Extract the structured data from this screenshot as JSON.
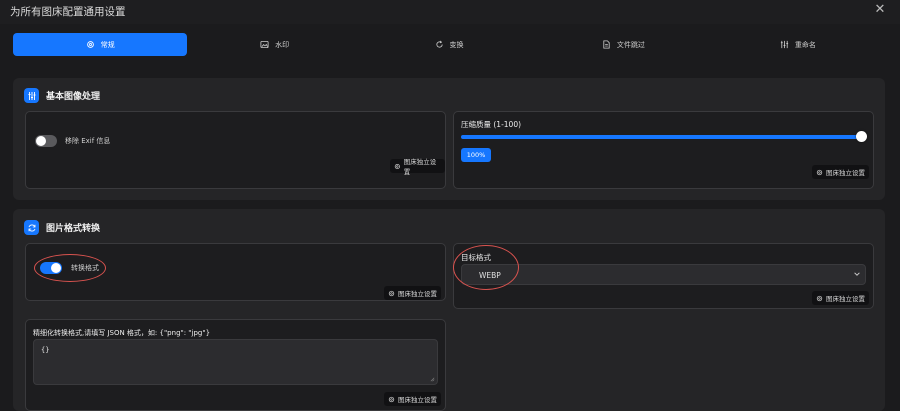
{
  "window": {
    "title": "为所有图床配置通用设置",
    "close_glyph": "✕"
  },
  "tabs": [
    {
      "label": "常规",
      "icon": "gear-icon",
      "active": true
    },
    {
      "label": "水印",
      "icon": "image-icon",
      "active": false
    },
    {
      "label": "变换",
      "icon": "rotate-icon",
      "active": false
    },
    {
      "label": "文件跳过",
      "icon": "file-icon",
      "active": false
    },
    {
      "label": "重命名",
      "icon": "sliders-icon",
      "active": false
    }
  ],
  "basic_processing": {
    "title": "基本图像处理",
    "remove_exif": {
      "label": "移除 Exif 信息",
      "enabled": false
    },
    "compression": {
      "label": "压缩质量 (1-100)",
      "value": 100,
      "value_label": "100%"
    },
    "independent_button": "图床独立设置"
  },
  "format_conversion": {
    "title": "图片格式转换",
    "convert_format": {
      "label": "转换格式",
      "enabled": true
    },
    "target_format": {
      "label": "目标格式",
      "value": "WEBP"
    },
    "fine_grained": {
      "label": "精细化转换格式,请填写 JSON 格式，如: {\"png\": \"jpg\"}",
      "value": "{}"
    },
    "independent_button": "图床独立设置"
  },
  "colors": {
    "accent": "#1677ff",
    "annotation": "#d9534f"
  }
}
